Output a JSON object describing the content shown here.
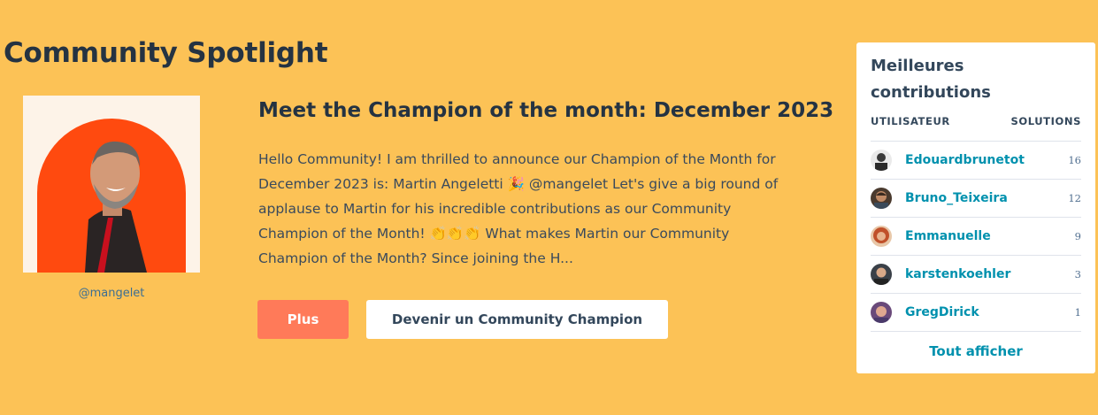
{
  "page": {
    "title": "Community Spotlight"
  },
  "spotlight": {
    "handle": "@mangelet",
    "title": "Meet the Champion of the month: December 2023",
    "body": "Hello Community! I am thrilled to announce our Champion of the Month for December 2023 is: Martin Angeletti 🎉 @mangelet Let's give a big round of applause to Martin for his incredible contributions as our Community Champion of the Month! 👏👏👏 What makes Martin our Community Champion of the Month? Since joining the H...",
    "more_label": "Plus",
    "champion_label": "Devenir un Community Champion",
    "colors": {
      "background": "#fcc256",
      "arch": "#ff4a0f",
      "more_button": "#ff7a59"
    }
  },
  "top_contributors": {
    "title": "Meilleures contributions",
    "col_user": "UTILISATEUR",
    "col_solutions": "SOLUTIONS",
    "rows": [
      {
        "name": "Edouardbrunetot",
        "solutions": "16",
        "avatar_color": "#d9d9d9"
      },
      {
        "name": "Bruno_Teixeira",
        "solutions": "12",
        "avatar_color": "#4a3a2e"
      },
      {
        "name": "Emmanuelle",
        "solutions": "9",
        "avatar_color": "#c0502a"
      },
      {
        "name": "karstenkoehler",
        "solutions": "3",
        "avatar_color": "#3a4048"
      },
      {
        "name": "GregDirick",
        "solutions": "1",
        "avatar_color": "#6a4a7a"
      }
    ],
    "view_all": "Tout afficher",
    "link_color": "#0091ae"
  }
}
